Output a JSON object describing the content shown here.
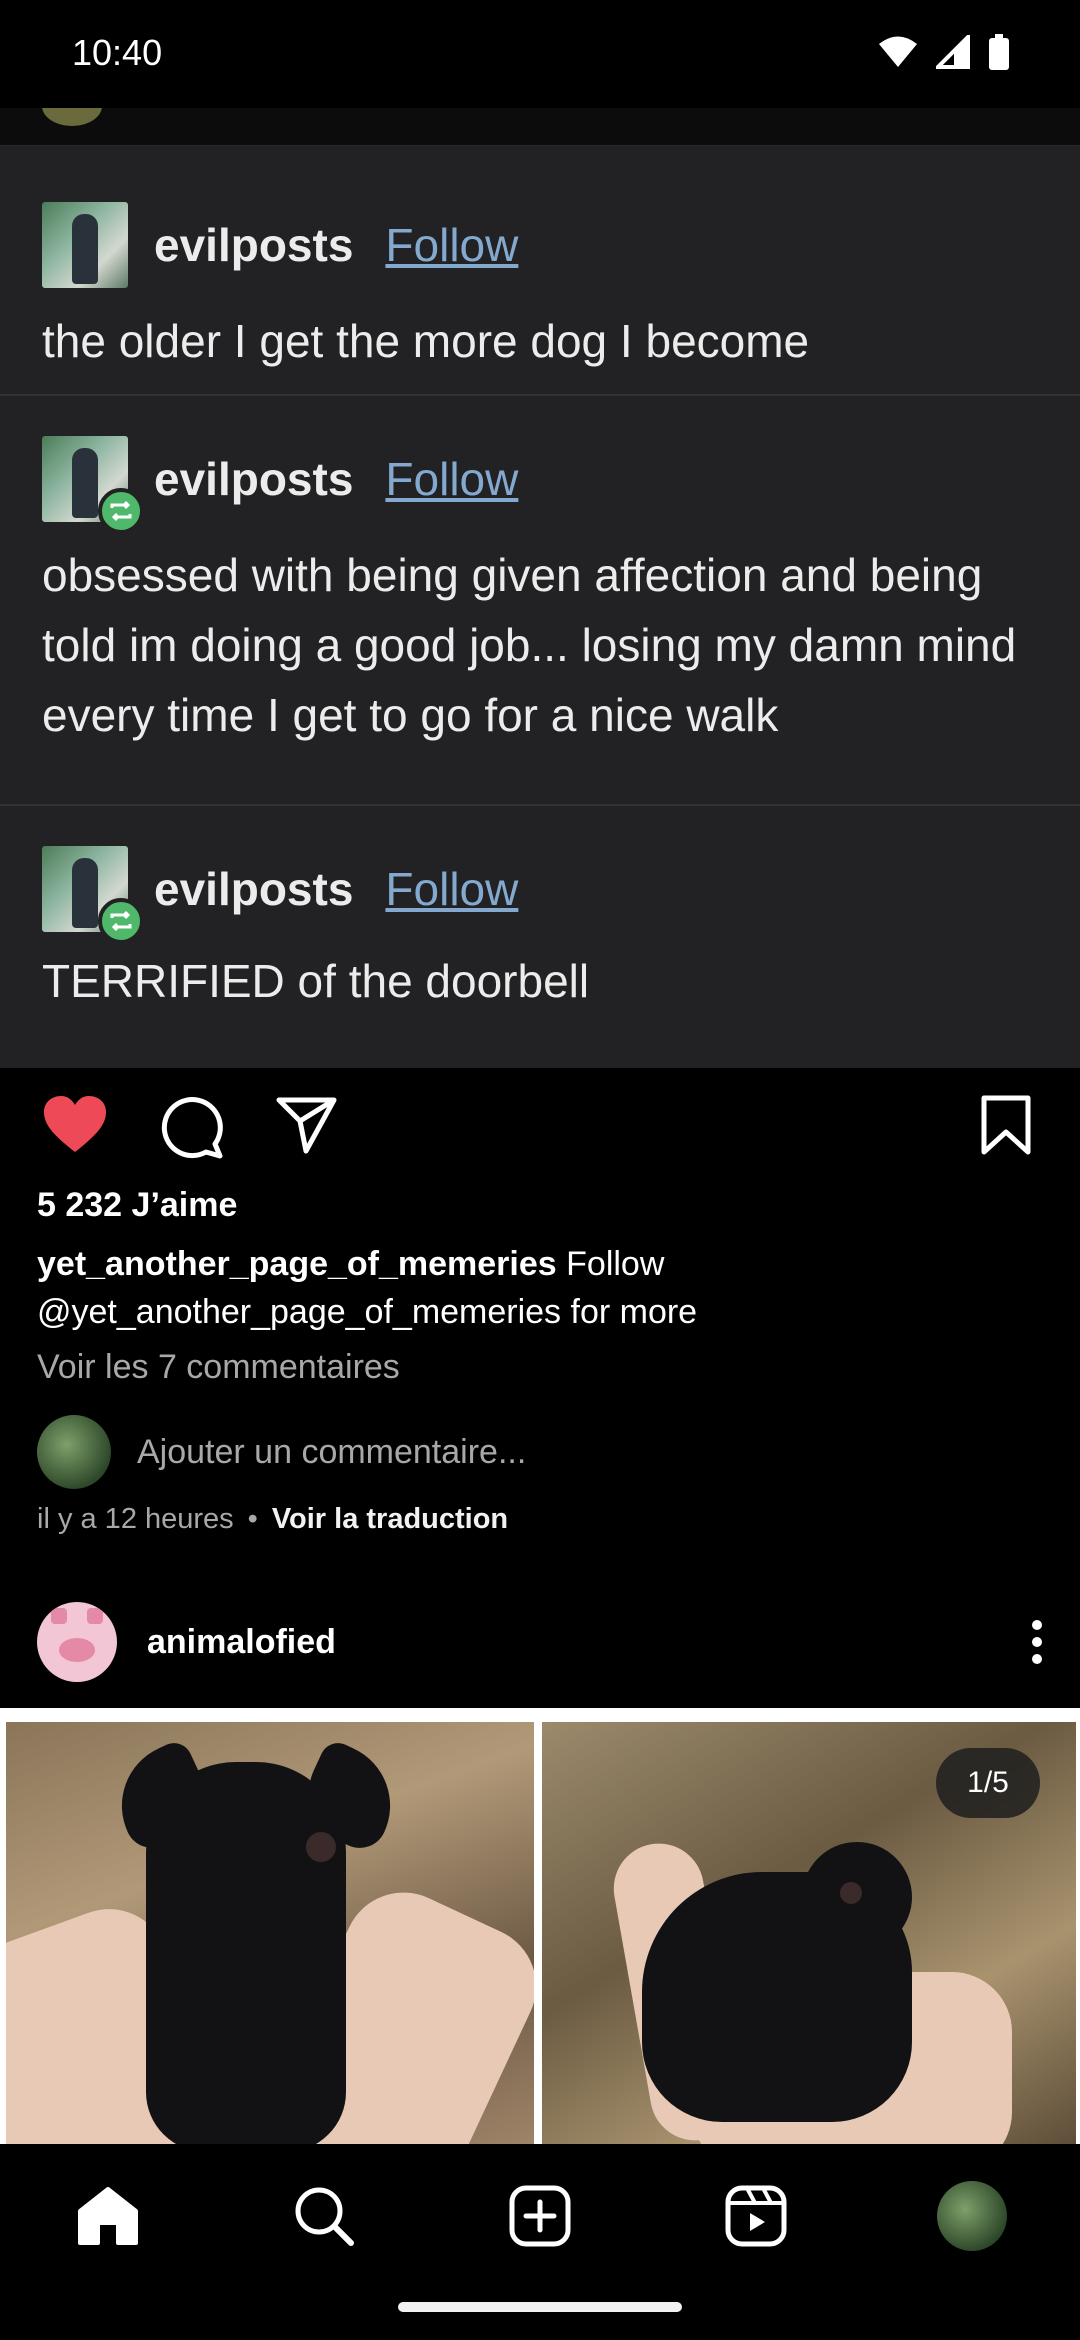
{
  "status_bar": {
    "time": "10:40"
  },
  "tumblr_posts": [
    {
      "username": "evilposts",
      "follow": "Follow",
      "body": "the older I get the more dog I become",
      "reblog": false
    },
    {
      "username": "evilposts",
      "follow": "Follow",
      "body": "obsessed with being given affection and being told im doing a good job... losing my damn mind every time I get to go for a nice walk",
      "reblog": true
    },
    {
      "username": "evilposts",
      "follow": "Follow",
      "body": "TERRIFIED of the doorbell",
      "reblog": true
    }
  ],
  "post1": {
    "likes": "5 232 J’aime",
    "caption_user": "yet_another_page_of_memeries",
    "caption_follow": "Follow",
    "caption_text": "@yet_another_page_of_memeries for more",
    "view_comments": "Voir les 7 commentaires",
    "add_comment_placeholder": "Ajouter un commentaire...",
    "time_ago": "il y a 12 heures",
    "separator": "•",
    "translate": "Voir la traduction",
    "liked": true,
    "icons": [
      "heart-filled-icon",
      "comment-icon",
      "share-icon",
      "bookmark-icon"
    ],
    "like_color": "#ed4956"
  },
  "post2": {
    "username": "animalofied",
    "counter": "1/5"
  },
  "bottom_nav": [
    "home-icon",
    "search-icon",
    "create-icon",
    "reels-icon",
    "profile-avatar"
  ]
}
